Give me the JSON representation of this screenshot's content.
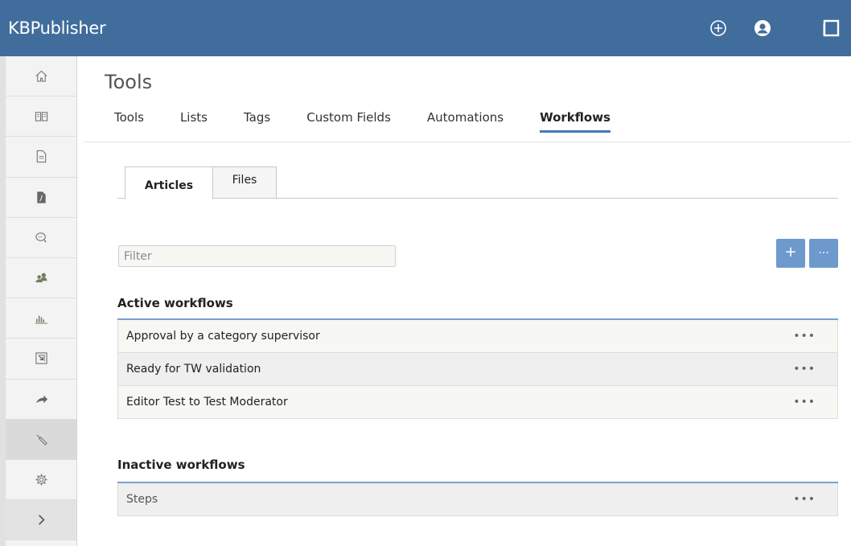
{
  "app": {
    "title": "KBPublisher"
  },
  "header": {
    "icons": [
      "add-circle-icon",
      "user-account-icon",
      "window-icon"
    ]
  },
  "sidebar": {
    "items": [
      {
        "icon": "home-icon"
      },
      {
        "icon": "book-icon"
      },
      {
        "icon": "document-icon"
      },
      {
        "icon": "pdf-file-icon"
      },
      {
        "icon": "comments-icon"
      },
      {
        "icon": "users-icon"
      },
      {
        "icon": "bar-chart-icon"
      },
      {
        "icon": "import-icon"
      },
      {
        "icon": "share-arrow-icon"
      },
      {
        "icon": "wrench-icon",
        "active": true
      },
      {
        "icon": "gear-icon"
      },
      {
        "icon": "chevron-right-icon"
      }
    ]
  },
  "page": {
    "title": "Tools"
  },
  "topnav": {
    "tabs": [
      "Tools",
      "Lists",
      "Tags",
      "Custom Fields",
      "Automations",
      "Workflows"
    ],
    "current": "Workflows"
  },
  "subtabs": {
    "tabs": [
      "Articles",
      "Files"
    ],
    "current": "Articles"
  },
  "filter": {
    "placeholder": "Filter",
    "value": ""
  },
  "buttons": {
    "add": "+",
    "more": "..."
  },
  "active": {
    "title": "Active workflows",
    "rows": [
      {
        "name": "Approval by a category supervisor",
        "menu": "•••"
      },
      {
        "name": "Ready for TW validation",
        "menu": "•••"
      },
      {
        "name": "Editor Test to Test Moderator",
        "menu": "•••"
      }
    ]
  },
  "inactive": {
    "title": "Inactive workflows",
    "rows": [
      {
        "name": "Steps",
        "menu": "•••"
      }
    ]
  },
  "colors": {
    "header": "#416d9c",
    "accent": "#4877b1",
    "button": "#6e99cd"
  }
}
